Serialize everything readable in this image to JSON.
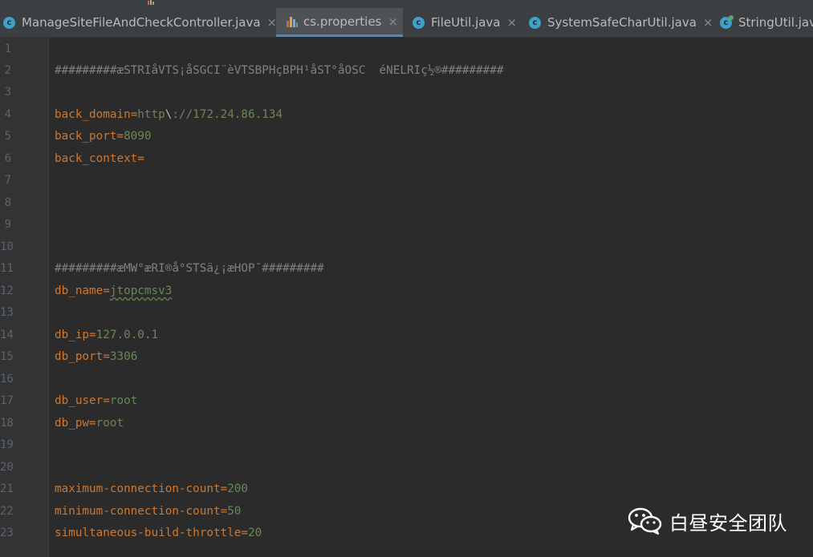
{
  "tabs": [
    {
      "label": "ManageSiteFileAndCheckController.java",
      "icon": "java-class-icon",
      "active": false,
      "closable": true
    },
    {
      "label": "cs.properties",
      "icon": "properties-file-icon",
      "active": true,
      "closable": true
    },
    {
      "label": "FileUtil.java",
      "icon": "java-class-icon",
      "active": false,
      "closable": true
    },
    {
      "label": "SystemSafeCharUtil.java",
      "icon": "java-class-icon",
      "active": false,
      "closable": true
    },
    {
      "label": "StringUtil.jav",
      "icon": "java-class-icon",
      "active": false,
      "closable": false
    }
  ],
  "close_glyph": "×",
  "class_glyph": "c",
  "editor": {
    "line_numbers": [
      "1",
      "2",
      "3",
      "4",
      "5",
      "6",
      "7",
      "8",
      "9",
      "10",
      "11",
      "12",
      "13",
      "14",
      "15",
      "16",
      "17",
      "18",
      "19",
      "20",
      "21",
      "22",
      "23"
    ],
    "lines": {
      "l2": "#########æSTRIåVTS¡åSGCI¨èVTSBPHçBPH¹åST°åOSC  éNELRIç½®#########",
      "l4_key": "back_domain",
      "l4_val_a": "http",
      "l4_esc": "\\",
      "l4_val_b": "://172.24.86.134",
      "l5_key": "back_port",
      "l5_val": "8090",
      "l6_key": "back_context",
      "l11": "#########æMW°æRI®å°STSä¿¡æHOP¯#########",
      "l12_key": "db_name",
      "l12_val": "jtopcmsv3",
      "l14_key": "db_ip",
      "l14_val": "127.0.0.1",
      "l15_key": "db_port",
      "l15_val": "3306",
      "l17_key": "db_user",
      "l17_val": "root",
      "l18_key": "db_pw",
      "l18_val": "root",
      "l21_key": "maximum-connection-count",
      "l21_val": "200",
      "l22_key": "minimum-connection-count",
      "l22_val": "50",
      "l23_key": "simultaneous-build-throttle",
      "l23_val": "20"
    },
    "equals": "="
  },
  "watermark": {
    "text": "白昼安全团队",
    "icon": "wechat-logo-icon"
  },
  "colors": {
    "editor_bg": "#2b2b2b",
    "gutter_bg": "#313335",
    "tabbar_bg": "#3c3f41",
    "active_tab_underline": "#4a88c7",
    "property_key": "#cc7832",
    "property_value": "#6a8759",
    "comment": "#808080",
    "line_number": "#606366"
  }
}
